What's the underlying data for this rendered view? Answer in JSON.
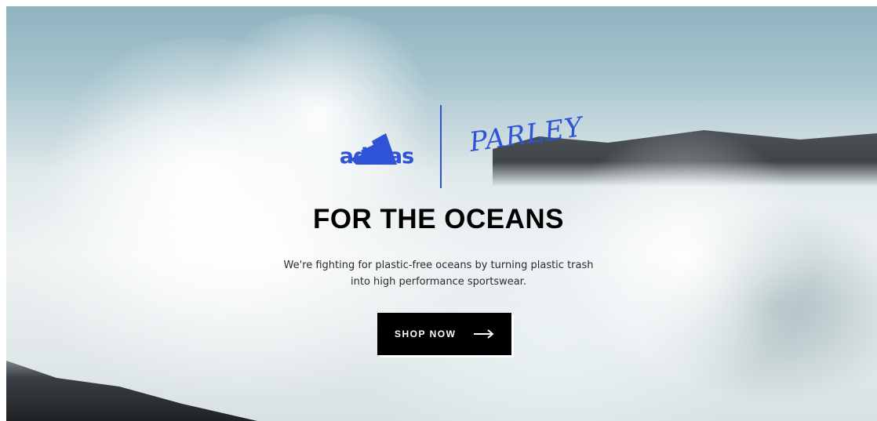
{
  "brand": {
    "adidas_text": "adidas",
    "parley_text": "PARLEY",
    "accent_color": "#2e53d6"
  },
  "hero": {
    "headline": "FOR THE OCEANS",
    "subtext": "We're fighting for plastic-free oceans by turning plastic trash into high performance sportswear.",
    "background": "ocean-wave-splash-photo"
  },
  "cta": {
    "label": "SHOP NOW",
    "icon": "arrow-right-icon"
  }
}
